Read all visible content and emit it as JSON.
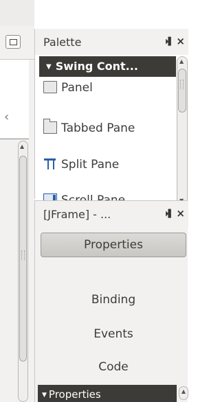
{
  "palette": {
    "title": "Palette",
    "pin_glyph": "⏵▌",
    "close_glyph": "×",
    "category": "Swing Cont...",
    "items": [
      {
        "label": "Panel",
        "icon": "panel-icon"
      },
      {
        "label": "Tabbed Pane",
        "icon": "tabbed-pane-icon"
      },
      {
        "label": "Split Pane",
        "icon": "split-pane-icon"
      },
      {
        "label": "Scroll Pane",
        "icon": "scroll-pane-icon"
      }
    ]
  },
  "properties_window": {
    "title": "[JFrame] - ...",
    "pin_glyph": "⏵▌",
    "close_glyph": "×",
    "tabs": [
      {
        "label": "Properties",
        "selected": true
      },
      {
        "label": "Binding"
      },
      {
        "label": "Events"
      },
      {
        "label": "Code"
      }
    ],
    "section": "Properties"
  },
  "left": {
    "chevron": "‹"
  },
  "colors": {
    "dark_bar": "#3c3b37",
    "panel_bg": "#f2f1f0",
    "icon_blue": "#2b5ea7"
  }
}
